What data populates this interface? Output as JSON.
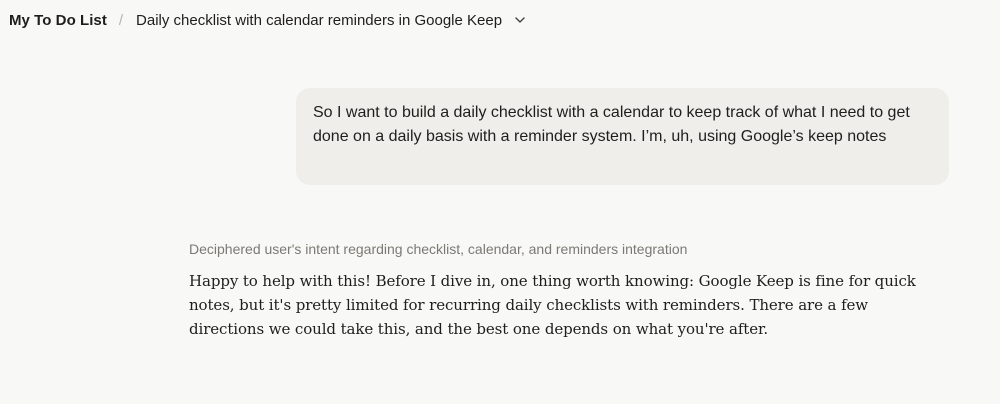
{
  "header": {
    "project": "My To Do List",
    "separator": "/",
    "conversation_title": "Daily checklist with calendar reminders in Google Keep",
    "dropdown_icon": "chevron-down-icon"
  },
  "conversation": {
    "user_message": "So I want to build a daily checklist with a calendar to keep track of what I need to get done on a daily basis with a reminder system. I’m, uh, using Google’s keep notes",
    "thinking_summary": "Deciphered user's intent regarding checklist, calendar, and reminders integration",
    "assistant_message": "Happy to help with this! Before I dive in, one thing worth knowing: Google Keep is fine for quick notes, but it's pretty limited for recurring daily checklists with reminders. There are a few directions we could take this, and the best one depends on what you're after."
  },
  "colors": {
    "background": "#f8f8f6",
    "user_bubble": "#efeeea",
    "text": "#1f1e1d",
    "muted_text": "#7b7972"
  }
}
